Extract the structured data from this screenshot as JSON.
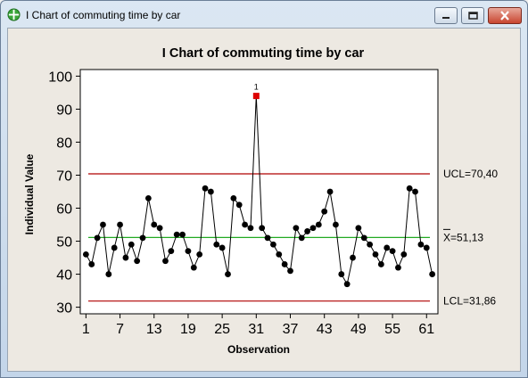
{
  "window": {
    "title": "I Chart of commuting time by car",
    "app_icon": "minitab-crosshair-icon",
    "controls": [
      "minimize-icon",
      "maximize-icon",
      "close-icon"
    ],
    "close_color": "#c8452f"
  },
  "chart_data": {
    "type": "line",
    "title": "I Chart of commuting time by car",
    "xlabel": "Observation",
    "ylabel": "Individual Value",
    "xlim": [
      0,
      63
    ],
    "ylim": [
      28,
      102
    ],
    "xticks": [
      1,
      7,
      13,
      19,
      25,
      31,
      37,
      43,
      49,
      55,
      61
    ],
    "yticks": [
      30,
      40,
      50,
      60,
      70,
      80,
      90,
      100
    ],
    "series": [
      {
        "values": [
          46,
          43,
          51,
          55,
          40,
          48,
          55,
          45,
          49,
          44,
          51,
          63,
          55,
          54,
          44,
          47,
          52,
          52,
          47,
          42,
          46,
          66,
          65,
          49,
          48,
          40,
          63,
          61,
          55,
          54,
          94,
          54,
          51,
          49,
          46,
          43,
          41,
          54,
          51,
          53,
          54,
          55,
          59,
          65,
          55,
          40,
          37,
          45,
          54,
          51,
          49,
          46,
          43,
          48,
          47,
          42,
          46,
          66,
          65,
          49,
          48,
          40
        ]
      }
    ],
    "control_limits": {
      "ucl": {
        "value": 70.4,
        "label": "UCL=70,40",
        "color": "#b00000"
      },
      "center": {
        "value": 51.13,
        "label": "X=51,13",
        "color": "#22aa22"
      },
      "lcl": {
        "value": 31.86,
        "label": "LCL=31,86",
        "color": "#b00000"
      }
    },
    "out_of_control": [
      {
        "observation": 31,
        "test_label": "1",
        "color": "#dd0000"
      }
    ],
    "grid": false,
    "legend": "none"
  }
}
